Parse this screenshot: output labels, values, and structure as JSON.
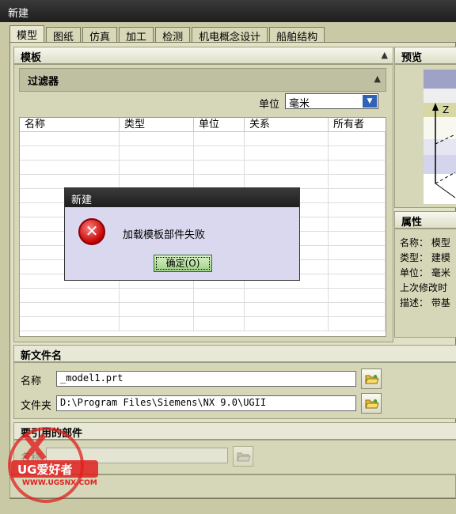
{
  "window": {
    "title": "新建"
  },
  "tabs": [
    "模型",
    "图纸",
    "仿真",
    "加工",
    "检测",
    "机电概念设计",
    "船舶结构"
  ],
  "template_section": {
    "title": "模板",
    "filter": {
      "title": "过滤器",
      "unit_label": "单位",
      "unit_value": "毫米"
    },
    "table": {
      "columns": [
        "名称",
        "类型",
        "单位",
        "关系",
        "所有者"
      ],
      "rows": []
    }
  },
  "preview_section": {
    "title": "预览",
    "axis_label": "Z"
  },
  "properties_section": {
    "title": "属性",
    "rows": [
      {
        "label": "名称：",
        "value": "模型"
      },
      {
        "label": "类型：",
        "value": "建模"
      },
      {
        "label": "单位：",
        "value": "毫米"
      },
      {
        "label": "上次修改时",
        "value": ""
      },
      {
        "label": "描述：",
        "value": "带基"
      }
    ]
  },
  "new_file_section": {
    "title": "新文件名",
    "name_label": "名称",
    "name_value": "_model1.prt",
    "folder_label": "文件夹",
    "folder_value": "D:\\Program Files\\Siemens\\NX 9.0\\UGII"
  },
  "reference_section": {
    "title": "要引用的部件",
    "name_label": "名称",
    "name_value": ""
  },
  "error_dialog": {
    "title": "新建",
    "message": "加载模板部件失败",
    "ok_label": "确定(O)"
  },
  "watermark": {
    "brand": "UG爱好者",
    "url": "WWW.UGSNX.COM"
  },
  "colors": {
    "background": "#c9c9a6",
    "titlebar": "#1e1e1e",
    "selection_blue": "#2f63b8",
    "dialog_bg": "#d9d8ee"
  }
}
